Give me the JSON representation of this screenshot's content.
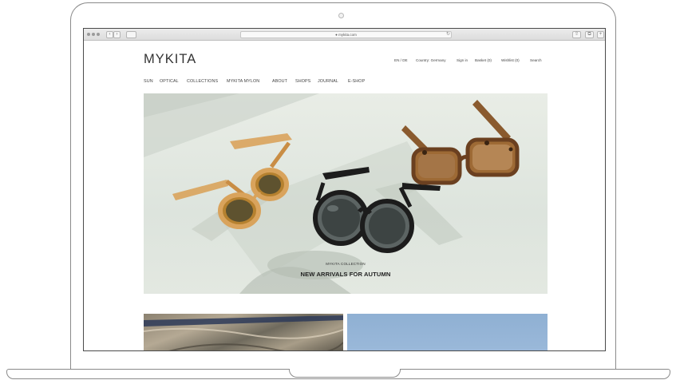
{
  "browser": {
    "address": "● mykita.com",
    "back_glyph": "‹",
    "forward_glyph": "›",
    "reload_glyph": "↻",
    "share_glyph": "⇧",
    "tabs_glyph": "⧉",
    "plus_glyph": "+"
  },
  "site": {
    "logo": "MYKITA",
    "utility": [
      "EN / DE",
      "Country: Germany",
      "Sign in",
      "Basket (0)",
      "Wishlist (0)",
      "Search"
    ],
    "nav": [
      "SUN",
      "OPTICAL",
      "COLLECTIONS",
      "MYKITA MYLON",
      "ABOUT",
      "SHOPS",
      "JOURNAL",
      "E-SHOP"
    ]
  },
  "hero": {
    "eyebrow": "MYKITA COLLECTION",
    "title": "NEW ARRIVALS FOR AUTUMN"
  },
  "colors": {
    "accent_tortoise": "#8a5a2e",
    "frame_amber": "#d9a35c",
    "frame_black": "#1c1c1c",
    "sky_tile": "#95b4d6"
  }
}
